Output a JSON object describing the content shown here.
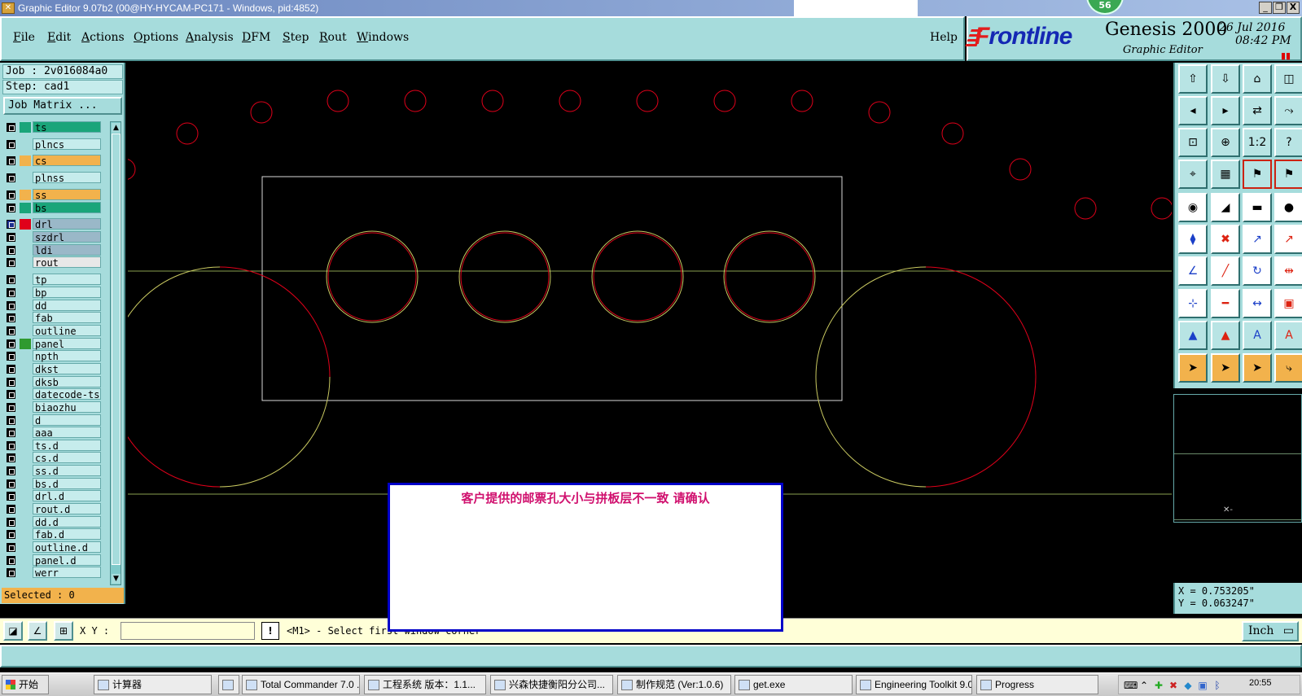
{
  "titlebar": {
    "title": "Graphic Editor 9.07b2 (00@HY-HYCAM-PC171 - Windows, pid:4852)",
    "badge": "56",
    "minimize": "_",
    "restore": "❐",
    "close": "X"
  },
  "menu": {
    "file": "File",
    "edit": "Edit",
    "actions": "Actions",
    "options": "Options",
    "analysis": "Analysis",
    "dfm": "DFM",
    "step": "Step",
    "rout": "Rout",
    "windows": "Windows",
    "help": "Help"
  },
  "brand": {
    "logo": "Frontline",
    "product": "Genesis 2000",
    "subtitle": "Graphic Editor",
    "date": "26 Jul 2016",
    "time": "08:42 PM"
  },
  "left": {
    "job": "Job : 2v016084a0",
    "step": "Step: cad1",
    "job_matrix": "Job Matrix ...",
    "selected": "Selected : 0"
  },
  "layers": [
    {
      "name": "ts",
      "bg": "#1aa57a",
      "color": "#1aa57a"
    },
    {
      "name": "plncs",
      "bg": "#c6ecec",
      "color": "#a6dcdc"
    },
    {
      "name": "cs",
      "bg": "#f2b24c",
      "color": "#f2b24c"
    },
    {
      "name": "plnss",
      "bg": "#c6ecec",
      "color": "#a6dcdc"
    },
    {
      "name": "ss",
      "bg": "#f2b24c",
      "color": "#f2b24c"
    },
    {
      "name": "bs",
      "bg": "#1aa57a",
      "color": "#1aa57a"
    },
    {
      "name": "drl",
      "bg": "#9ab8c8",
      "color": "#e0001a"
    },
    {
      "name": "szdrl",
      "bg": "#9ab8c8",
      "color": "#a6dcdc"
    },
    {
      "name": "ldi",
      "bg": "#9ab8c8",
      "color": "#a6dcdc"
    },
    {
      "name": "rout",
      "bg": "#e8e8e8",
      "color": "#a6dcdc"
    },
    {
      "name": "tp",
      "bg": "#c6ecec",
      "color": "#a6dcdc"
    },
    {
      "name": "bp",
      "bg": "#c6ecec",
      "color": "#a6dcdc"
    },
    {
      "name": "dd",
      "bg": "#c6ecec",
      "color": "#a6dcdc"
    },
    {
      "name": "fab",
      "bg": "#c6ecec",
      "color": "#a6dcdc"
    },
    {
      "name": "outline",
      "bg": "#c6ecec",
      "color": "#a6dcdc"
    },
    {
      "name": "panel",
      "bg": "#c6ecec",
      "color": "#2f9a2f"
    },
    {
      "name": "npth",
      "bg": "#c6ecec",
      "color": "#a6dcdc"
    },
    {
      "name": "dkst",
      "bg": "#c6ecec",
      "color": "#a6dcdc"
    },
    {
      "name": "dksb",
      "bg": "#c6ecec",
      "color": "#a6dcdc"
    },
    {
      "name": "datecode-ts",
      "bg": "#c6ecec",
      "color": "#a6dcdc"
    },
    {
      "name": "biaozhu",
      "bg": "#c6ecec",
      "color": "#a6dcdc"
    },
    {
      "name": "d",
      "bg": "#c6ecec",
      "color": "#a6dcdc"
    },
    {
      "name": "aaa",
      "bg": "#c6ecec",
      "color": "#a6dcdc"
    },
    {
      "name": "ts.d",
      "bg": "#c6ecec",
      "color": "#a6dcdc"
    },
    {
      "name": "cs.d",
      "bg": "#c6ecec",
      "color": "#a6dcdc"
    },
    {
      "name": "ss.d",
      "bg": "#c6ecec",
      "color": "#a6dcdc"
    },
    {
      "name": "bs.d",
      "bg": "#c6ecec",
      "color": "#a6dcdc"
    },
    {
      "name": "drl.d",
      "bg": "#c6ecec",
      "color": "#a6dcdc"
    },
    {
      "name": "rout.d",
      "bg": "#c6ecec",
      "color": "#a6dcdc"
    },
    {
      "name": "dd.d",
      "bg": "#c6ecec",
      "color": "#a6dcdc"
    },
    {
      "name": "fab.d",
      "bg": "#c6ecec",
      "color": "#a6dcdc"
    },
    {
      "name": "outline.d",
      "bg": "#c6ecec",
      "color": "#a6dcdc"
    },
    {
      "name": "panel.d",
      "bg": "#c6ecec",
      "color": "#a6dcdc"
    },
    {
      "name": "werr",
      "bg": "#c6ecec",
      "color": "#a6dcdc"
    }
  ],
  "toolbar_icons": [
    "zoom-home-icon",
    "zoom-out-icon",
    "home-icon",
    "split-view-icon",
    "pan-left-icon",
    "pan-right-icon",
    "swap-icon",
    "snap-icon",
    "fit-icon",
    "fit-center-icon",
    "ratio-1-2-icon",
    "query-icon",
    "measure-tool-icon",
    "grid-icon",
    "net-highlight-icon",
    "net-compare-icon",
    "move-icon",
    "delete-icon",
    "ruler-icon",
    "pad-icon",
    "connect-icon",
    "cross-icon",
    "line-point-icon",
    "segment-icon",
    "draw-angle-icon",
    "draw-line-icon",
    "rotate-icon",
    "mirror-icon",
    "point-add-icon",
    "line-split-icon",
    "resize-icon",
    "copy-icon",
    "triangle-warn-icon",
    "triangle-a-icon",
    "triangle-b-icon",
    "triangle-c-icon",
    "select-icon",
    "select-box-icon",
    "select-circle-icon",
    "select-net-icon"
  ],
  "toolbar_labels": {
    "ratio": "1:2",
    "query": "?"
  },
  "coords": {
    "x": "X = 0.753205\"",
    "y": "Y = 0.063247\""
  },
  "command": {
    "xy_label": "X Y :",
    "xy_value": "",
    "warn": "!",
    "prompt": "<M1> - Select first window corner",
    "unit": "Inch"
  },
  "message": {
    "text": "客户提供的邮票孔大小与拼板层不一致 请确认"
  },
  "taskbar": {
    "start": "开始",
    "tasks": [
      {
        "label": "计算器"
      },
      {
        "label": ""
      },
      {
        "label": "Total Commander 7.0 ..."
      },
      {
        "label": "工程系统  版本：1.1..."
      },
      {
        "label": "兴森快捷衡阳分公司..."
      },
      {
        "label": "制作规范 (Ver:1.0.6)"
      },
      {
        "label": "get.exe"
      },
      {
        "label": "Engineering Toolkit 9.0..."
      },
      {
        "label": "Progress"
      }
    ],
    "clock": "20:55"
  },
  "colors": {
    "panel": "#a6dcdc",
    "canvas": "#000000",
    "drill": "#e0001a",
    "outline": "#d8d8a0",
    "grid": "#8aa050",
    "dialog_border": "#0000c8",
    "message": "#d0106e"
  }
}
